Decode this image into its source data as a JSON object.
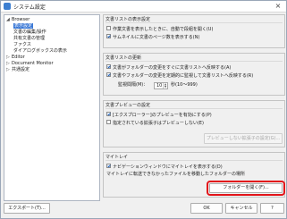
{
  "window": {
    "title": "システム設定",
    "close": "×"
  },
  "tree": {
    "items": [
      {
        "label": "Browser",
        "expander": "◢"
      },
      {
        "label": "表示設定",
        "expander": ""
      },
      {
        "label": "文書の編集/操作",
        "expander": ""
      },
      {
        "label": "共有文書の管理",
        "expander": ""
      },
      {
        "label": "ファクス",
        "expander": ""
      },
      {
        "label": "ダイアログボックスの表示",
        "expander": ""
      },
      {
        "label": "Editor",
        "expander": "▷"
      },
      {
        "label": "Document Monitor",
        "expander": "▷"
      },
      {
        "label": "共通設定",
        "expander": "▷"
      }
    ]
  },
  "groups": {
    "display": {
      "title": "文書リストの表示設定",
      "opt1": "作業文書を表示したときに、自動で段組を開く(U)",
      "opt2": "サムネイルに文書のページ数を表示する(N)"
    },
    "update": {
      "title": "文書リストの更新",
      "opt1": "文書がフォルダーの変更をすぐに文書リストへ反映する(A)",
      "opt2": "文書やフォルダーの変更を定期的に監視して文書リストへ反映する(R)",
      "interval_label": "監視間隔(M)：",
      "interval_value": "10",
      "interval_unit": "秒(10～999)"
    },
    "preview": {
      "title": "文書プレビューの設定",
      "opt1": "[エクスプローラー]のプレビューを有効にする(P)",
      "opt2": "指定されている拡張子はプレビューしない(E)",
      "button": "プレビューしない拡張子の設定(G)..."
    },
    "mytray": {
      "title": "マイトレイ",
      "opt1": "ナビゲーションウィンドウにマイトレイを表示する(D)",
      "note": "マイトレイに転送できなかったファイルを移動したフォルダーの場所",
      "button": "フォルダーを開く(F)..."
    }
  },
  "footer": {
    "export": "エクスポート(T)...",
    "ok": "OK",
    "cancel": "キャンセル",
    "help": "?"
  }
}
